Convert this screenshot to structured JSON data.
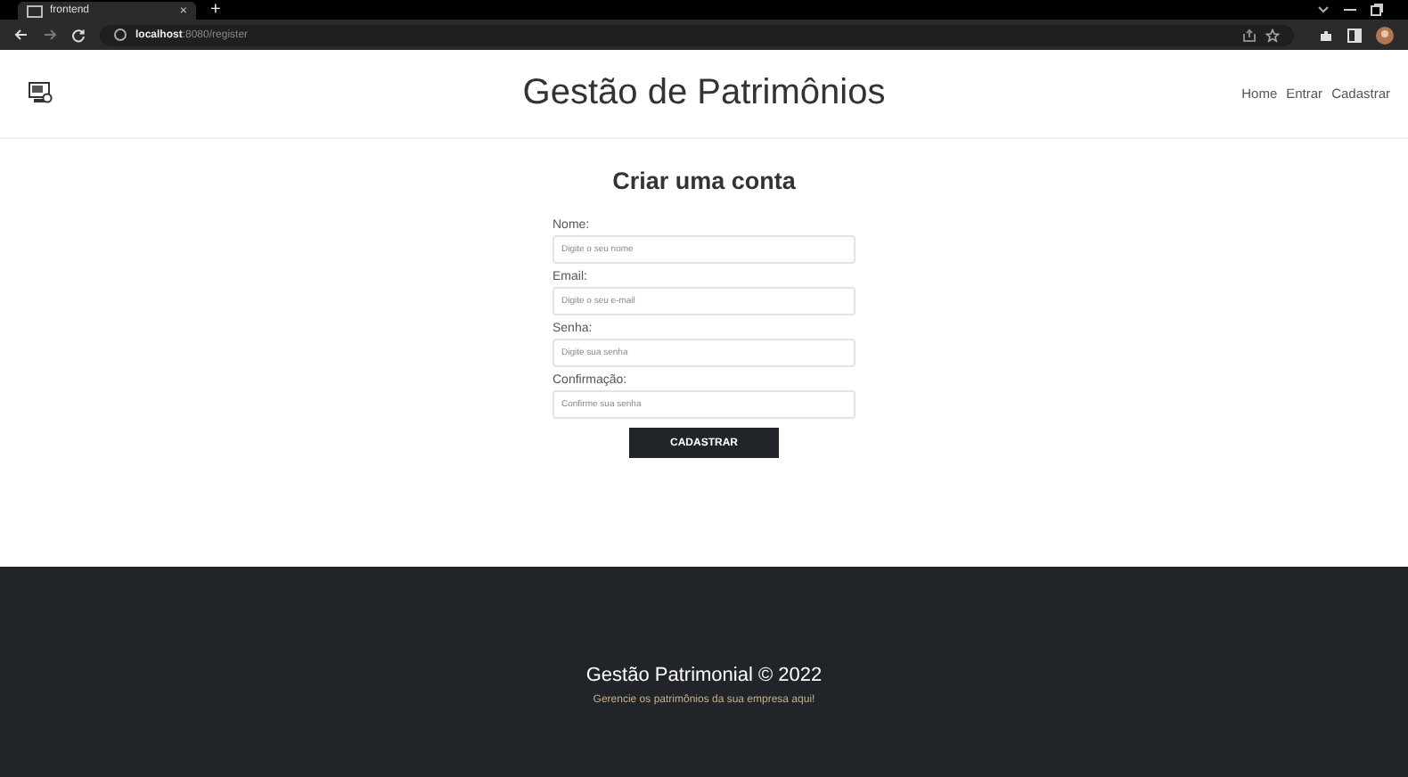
{
  "browser": {
    "tab_title": "frontend",
    "tab_close": "×",
    "new_tab": "+",
    "url_host": "localhost",
    "url_path": ":8080/register"
  },
  "header": {
    "title": "Gestão de Patrimônios",
    "nav": [
      {
        "label": "Home"
      },
      {
        "label": "Entrar"
      },
      {
        "label": "Cadastrar"
      }
    ]
  },
  "form": {
    "title": "Criar uma conta",
    "fields": [
      {
        "label": "Nome:",
        "placeholder": "Digite o seu nome"
      },
      {
        "label": "Email:",
        "placeholder": "Digite o seu e-mail"
      },
      {
        "label": "Senha:",
        "placeholder": "Digite sua senha"
      },
      {
        "label": "Confirmação:",
        "placeholder": "Confirme sua senha"
      }
    ],
    "button": "CADASTRAR"
  },
  "footer": {
    "title": "Gestão Patrimonial © 2022",
    "subtitle": "Gerencie os patrimônios da sua empresa aqui!"
  }
}
